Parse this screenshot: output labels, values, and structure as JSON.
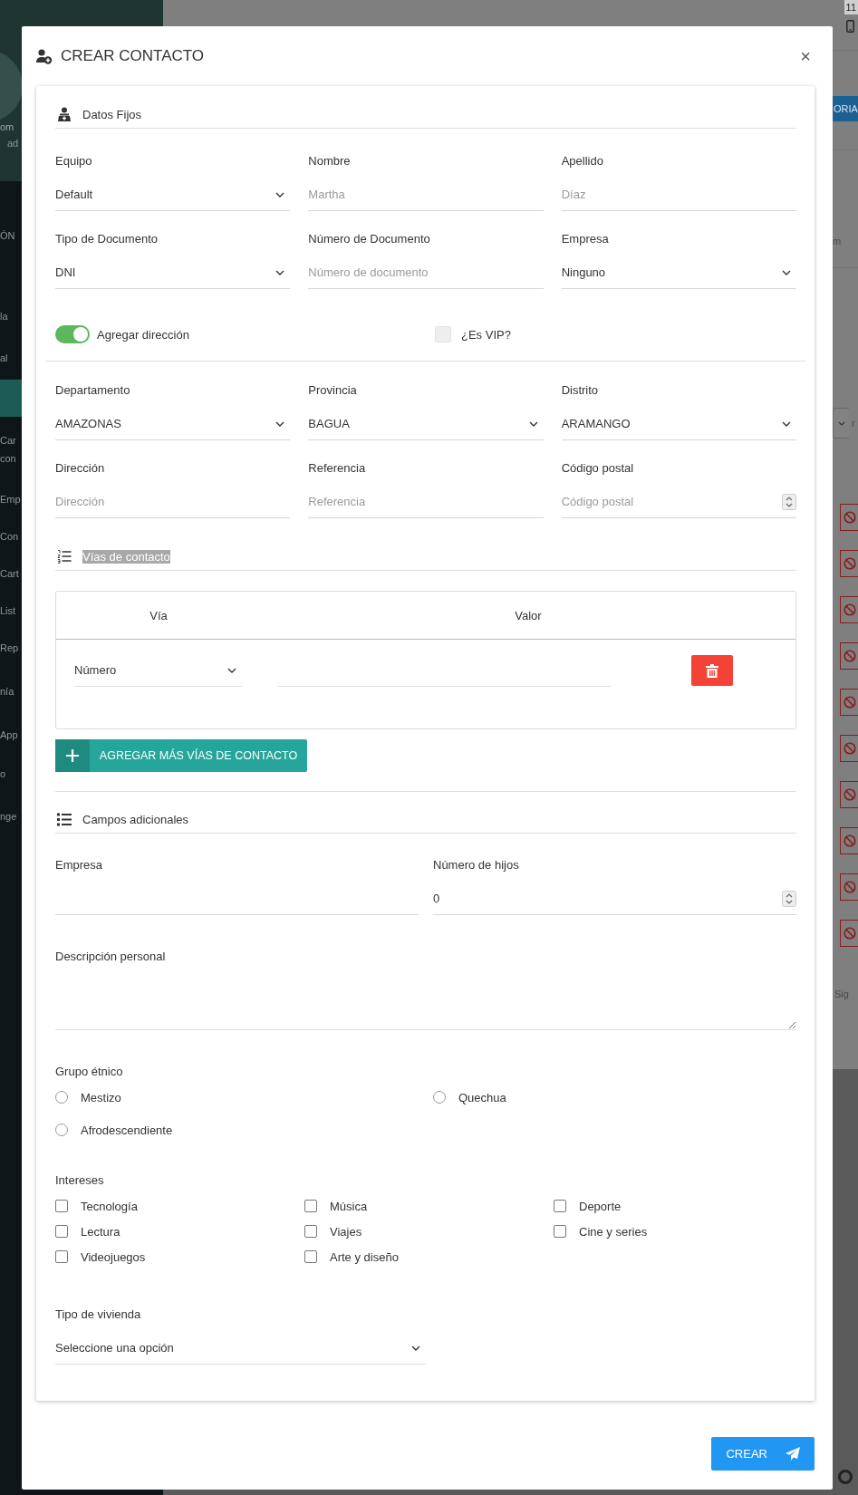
{
  "sidebar": {
    "user_name": "om",
    "user_role": "ad",
    "section_label": "ÓN",
    "items": [
      {
        "label": "la",
        "selected": false
      },
      {
        "label": "al",
        "selected": false
      },
      {
        "selected": true
      },
      {
        "label": "Car con",
        "selected": false
      },
      {
        "label": "Emp",
        "selected": false
      },
      {
        "label": "Con",
        "selected": false
      },
      {
        "label": "Cart",
        "selected": false
      },
      {
        "label": "List",
        "selected": false
      },
      {
        "label": "Rep",
        "selected": false
      },
      {
        "label": "nía",
        "selected": false
      },
      {
        "label": "App",
        "selected": false
      },
      {
        "label": "o",
        "selected": false
      },
      {
        "label": "nge",
        "selected": false
      }
    ]
  },
  "right_strip": {
    "clock": "11",
    "button_fragment": "ORIA",
    "header_fragment": "m",
    "select_fragment": "r",
    "next_fragment": "Sig",
    "rows": [
      {
        "kind": "blocked"
      },
      {
        "kind": "blocked"
      },
      {
        "kind": "blocked"
      },
      {
        "kind": "blocked"
      },
      {
        "kind": "blocked"
      },
      {
        "kind": "blocked"
      },
      {
        "kind": "blocked"
      },
      {
        "kind": "blocked"
      },
      {
        "kind": "blocked"
      },
      {
        "kind": "blocked"
      }
    ]
  },
  "modal": {
    "title": "CREAR CONTACTO",
    "close": "×",
    "fixed_section": {
      "title": "Datos Fijos",
      "fields": [
        {
          "kind": "select",
          "label": "Equipo",
          "value": "Default"
        },
        {
          "kind": "text",
          "label": "Nombre",
          "placeholder": "Martha"
        },
        {
          "kind": "text",
          "label": "Apellido",
          "placeholder": "Díaz"
        },
        {
          "kind": "select",
          "label": "Tipo de Documento",
          "value": "DNI"
        },
        {
          "kind": "text",
          "label": "Número de Documento",
          "placeholder": "Número de documento"
        },
        {
          "kind": "select",
          "label": "Empresa",
          "value": "Ninguno"
        }
      ],
      "address_toggle": {
        "label": "Agregar dirección",
        "on": true
      },
      "vip": {
        "label": "¿Es VIP?",
        "checked": false,
        "disabled": true
      },
      "address_fields": [
        {
          "kind": "select",
          "label": "Departamento",
          "value": "AMAZONAS"
        },
        {
          "kind": "select",
          "label": "Provincia",
          "value": "BAGUA"
        },
        {
          "kind": "select",
          "label": "Distrito",
          "value": "ARAMANGO"
        },
        {
          "kind": "text",
          "label": "Dirección",
          "placeholder": "Dirección"
        },
        {
          "kind": "text",
          "label": "Referencia",
          "placeholder": "Referencia"
        },
        {
          "kind": "number",
          "label": "Código postal",
          "placeholder": "Código postal"
        }
      ]
    },
    "contact_section": {
      "title": "Vías de contacto",
      "highlighted": true,
      "columns": [
        "Vía",
        "Valor"
      ],
      "rows": [
        {
          "via": "Número"
        }
      ],
      "add_button": "AGREGAR MÁS VÍAS DE CONTACTO"
    },
    "extra_section": {
      "title": "Campos adicionales",
      "fields": [
        {
          "kind": "text",
          "label": "Empresa"
        },
        {
          "kind": "number",
          "label": "Número de hijos",
          "value": "0"
        }
      ],
      "description": {
        "label": "Descripción personal"
      },
      "ethnic_group": {
        "label": "Grupo étnico",
        "options": [
          {
            "label": "Mestizo",
            "selected": false
          },
          {
            "label": "Quechua",
            "selected": false
          },
          {
            "label": "Afrodescendiente",
            "selected": false
          }
        ]
      },
      "interests": {
        "label": "Intereses",
        "options": [
          {
            "label": "Tecnología",
            "checked": false
          },
          {
            "label": "Música",
            "checked": false
          },
          {
            "label": "Deporte",
            "checked": false
          },
          {
            "label": "Lectura",
            "checked": false
          },
          {
            "label": "Viajes",
            "checked": false
          },
          {
            "label": "Cine y series",
            "checked": false
          },
          {
            "label": "Videojuegos",
            "checked": false
          },
          {
            "label": "Arte y diseño",
            "checked": false
          }
        ]
      },
      "housing": {
        "label": "Tipo de vivienda",
        "value": "Seleccione una opción"
      }
    },
    "submit": "CREAR"
  }
}
